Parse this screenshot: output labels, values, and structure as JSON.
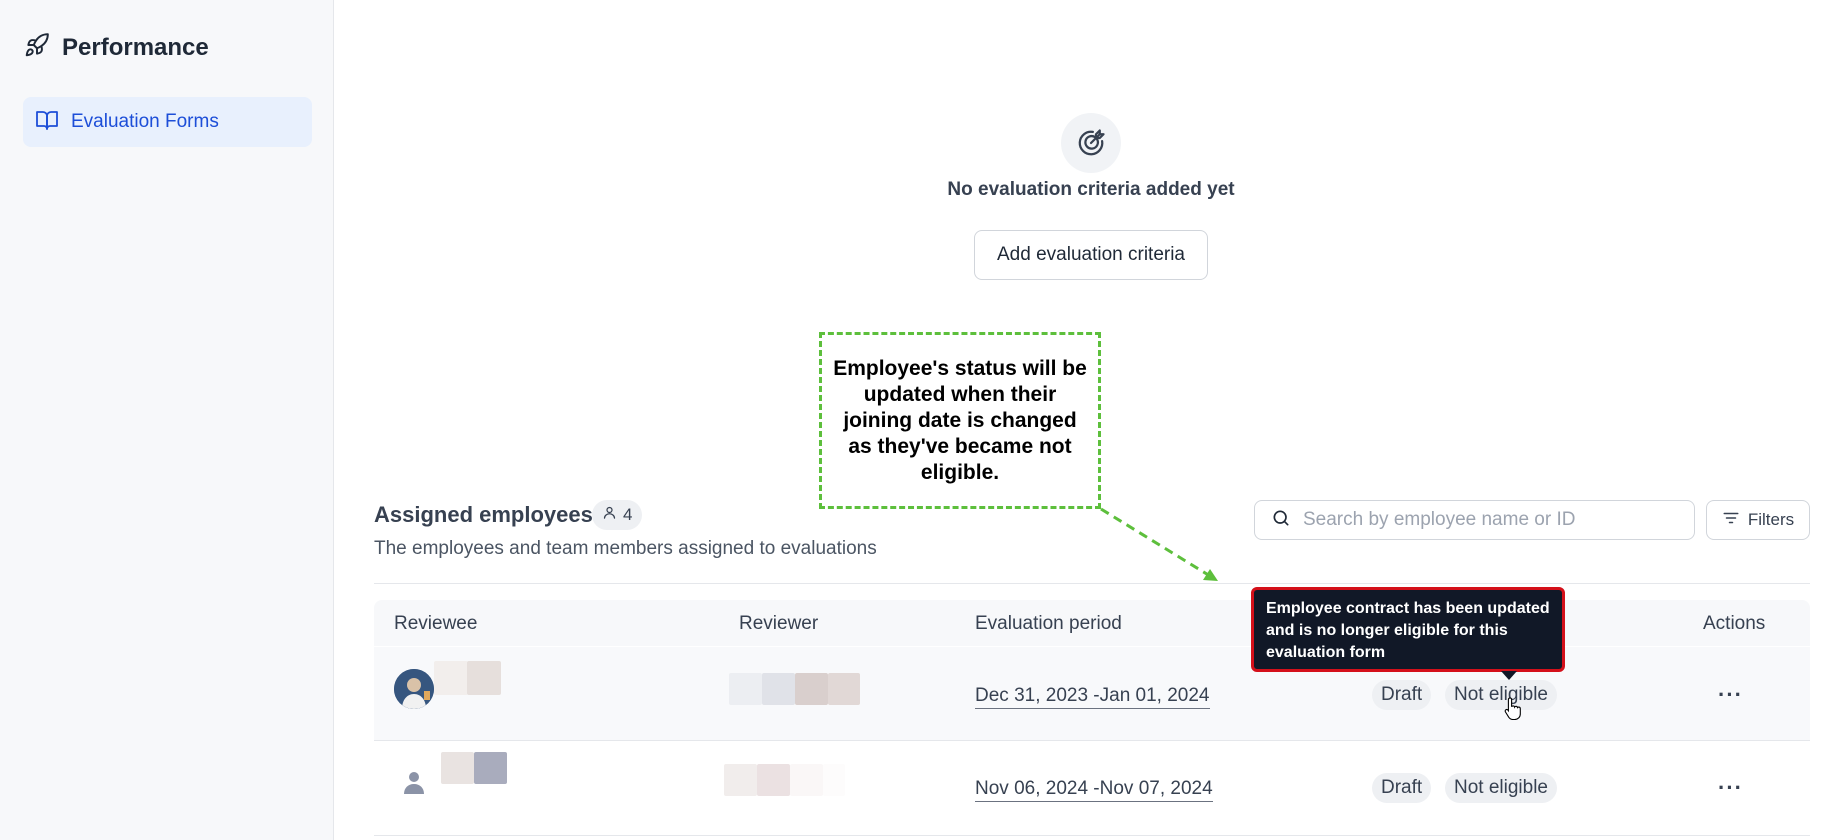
{
  "sidebar": {
    "app_title": "Performance",
    "nav_items": [
      {
        "label": "Evaluation Forms",
        "active": true
      }
    ]
  },
  "empty_state": {
    "title": "No evaluation criteria added yet",
    "button_label": "Add evaluation criteria"
  },
  "annotation": {
    "text": "Employee's status will be updated when their joining date is changed as they've became not eligible.",
    "border_color": "#5dbf3c"
  },
  "assigned": {
    "title": "Assigned employees",
    "count": "4",
    "subtitle": "The employees and team members assigned to evaluations",
    "search_placeholder": "Search by employee name or ID",
    "filters_label": "Filters"
  },
  "table": {
    "columns": {
      "reviewee": "Reviewee",
      "reviewer": "Reviewer",
      "period": "Evaluation period",
      "actions": "Actions"
    },
    "rows": [
      {
        "period": "Dec 31, 2023 -Jan 01, 2024",
        "status": "Draft",
        "eligibility": "Not eligible",
        "actions_label": "···"
      },
      {
        "period": "Nov 06, 2024 -Nov 07, 2024",
        "status": "Draft",
        "eligibility": "Not eligible",
        "actions_label": "···"
      }
    ]
  },
  "tooltip": {
    "text": "Employee contract has been updated and is no longer eligible for this evaluation form",
    "border_color": "#d4101a"
  },
  "colors": {
    "accent": "#1d4ed8",
    "nav_active_bg": "#e8f0fd"
  }
}
